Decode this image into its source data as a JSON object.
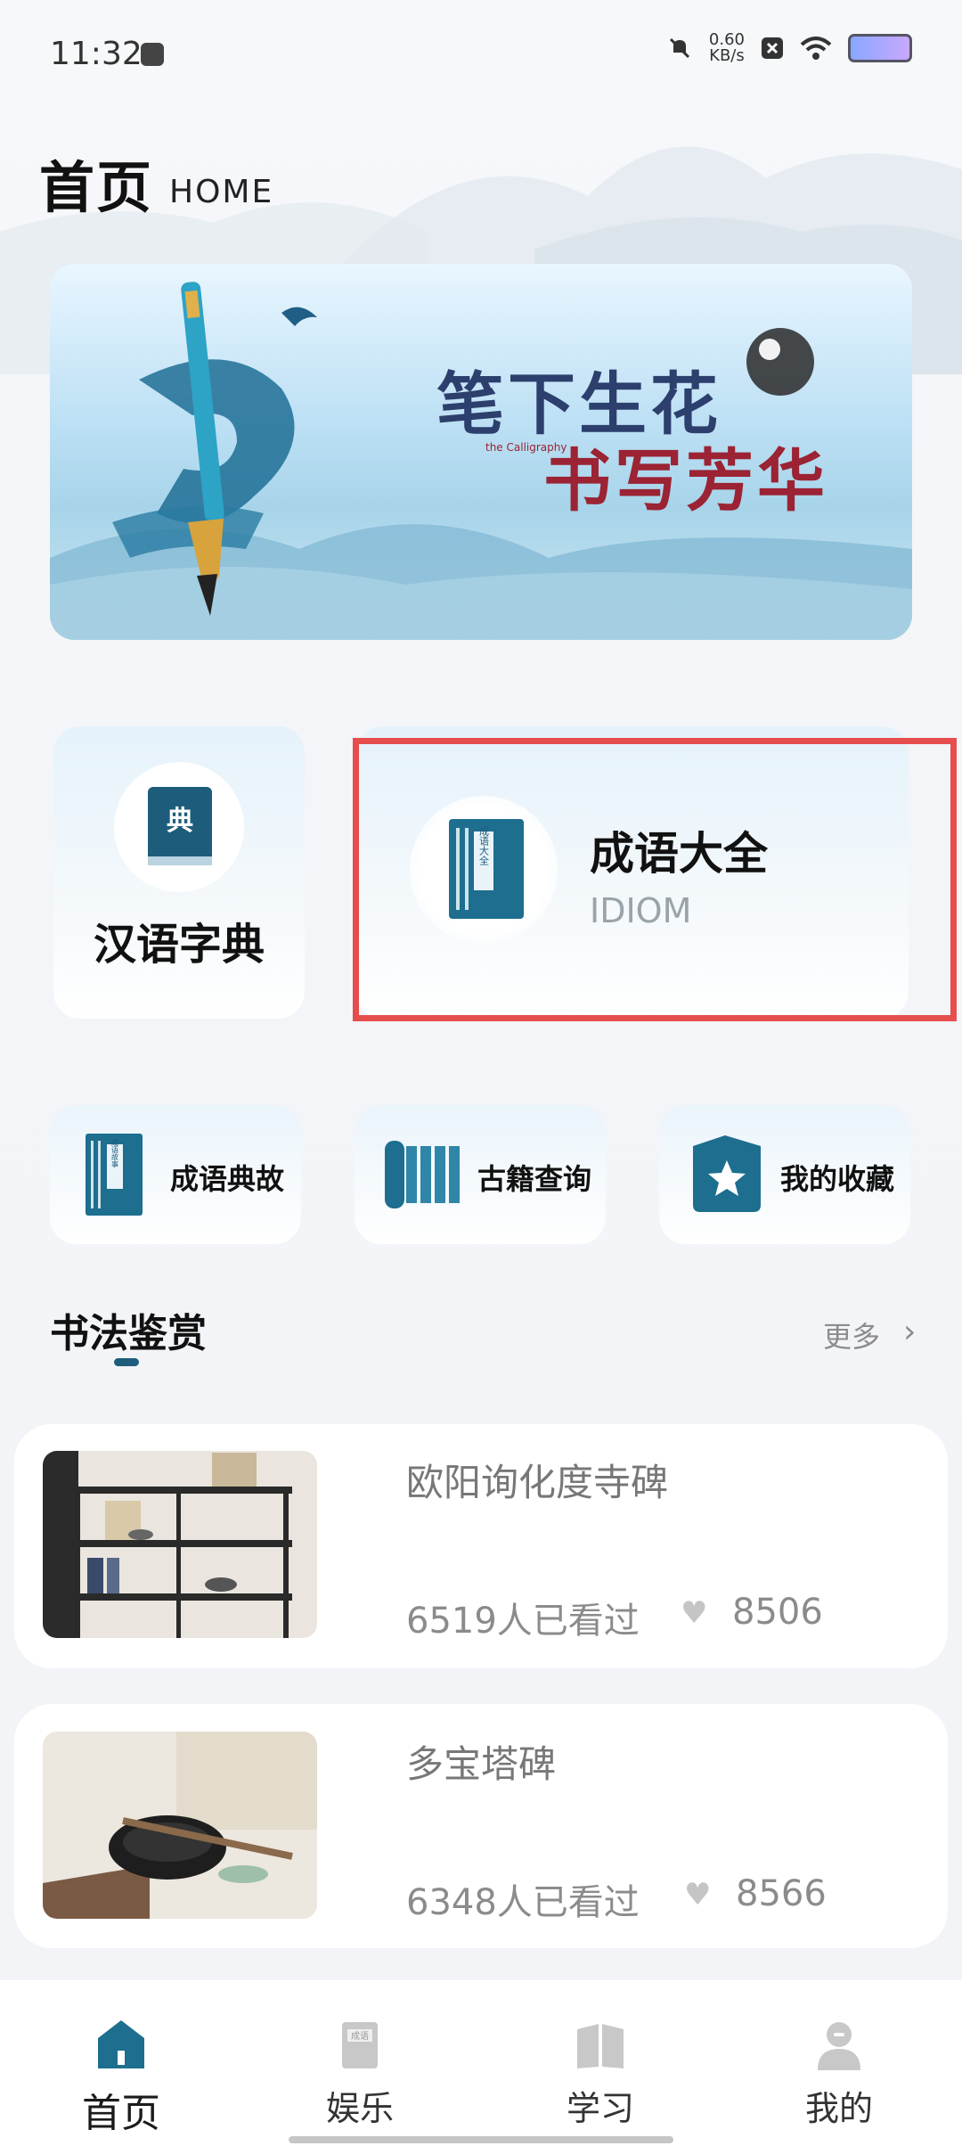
{
  "status": {
    "time": "11:32",
    "speed_top": "0.60",
    "speed_bottom": "KB/s"
  },
  "header": {
    "title": "首页",
    "subtitle": "HOME"
  },
  "banner": {
    "line1": "笔下生花",
    "line2": "书写芳华",
    "small": "the Calligraphy"
  },
  "cards": {
    "dictionary": {
      "label": "汉语字典",
      "icon_char": "典"
    },
    "idiom": {
      "label": "成语大全",
      "sub": "IDIOM",
      "spine_text": "成语大全"
    }
  },
  "features": [
    {
      "label": "成语典故",
      "spine_text": "成语故事"
    },
    {
      "label": "古籍查询"
    },
    {
      "label": "我的收藏"
    }
  ],
  "section": {
    "title": "书法鉴赏",
    "more": "更多",
    "chevron": "›"
  },
  "items": [
    {
      "title": "欧阳询化度寺碑",
      "views": "6519人已看过",
      "likes": "8506"
    },
    {
      "title": "多宝塔碑",
      "views": "6348人已看过",
      "likes": "8566"
    }
  ],
  "nav": [
    {
      "label": "首页"
    },
    {
      "label": "娱乐",
      "icon_text": "成语"
    },
    {
      "label": "学习"
    },
    {
      "label": "我的"
    }
  ],
  "colors": {
    "accent": "#1d5d7b",
    "highlight": "#e64d4d"
  }
}
